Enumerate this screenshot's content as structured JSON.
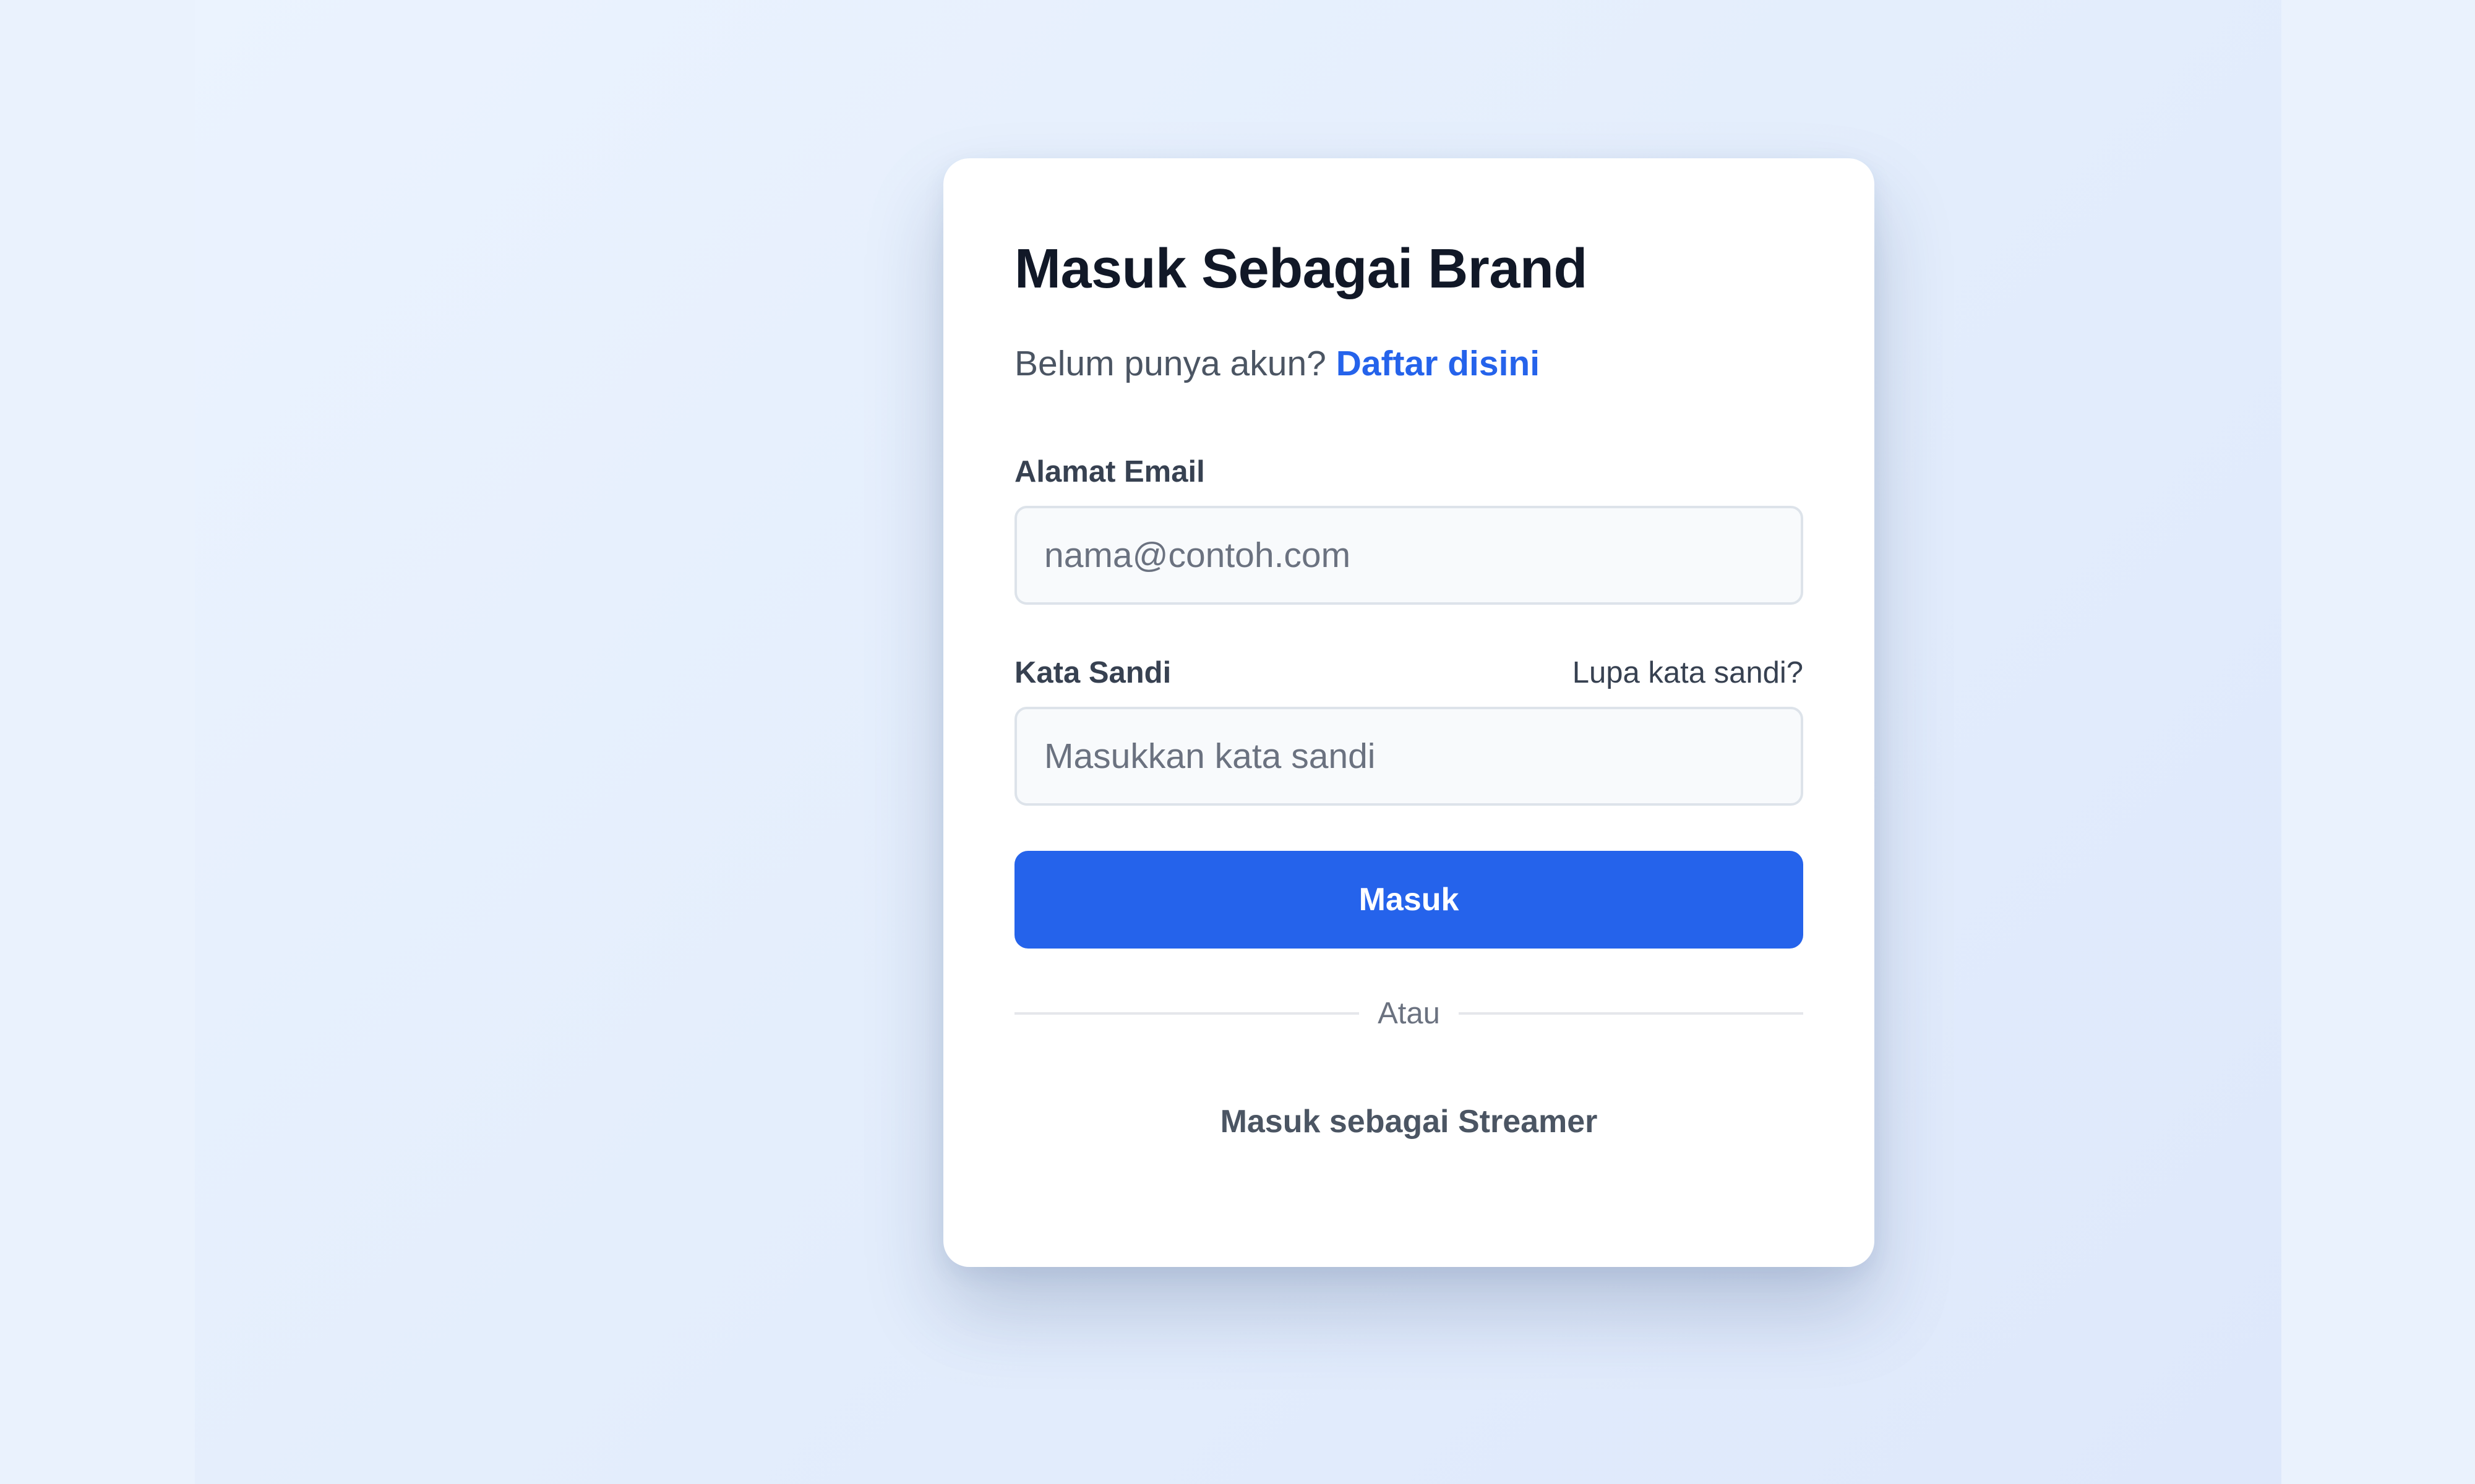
{
  "login": {
    "title": "Masuk Sebagai Brand",
    "subtitle_text": "Belum punya akun?",
    "register_link": "Daftar disini",
    "email_label": "Alamat Email",
    "email_placeholder": "nama@contoh.com",
    "password_label": "Kata Sandi",
    "forgot_link": "Lupa kata sandi?",
    "password_placeholder": "Masukkan kata sandi",
    "submit_label": "Masuk",
    "divider_text": "Atau",
    "alt_login_link": "Masuk sebagai Streamer"
  },
  "colors": {
    "accent": "#2563eb",
    "background": "#e7f0fd",
    "card": "#ffffff",
    "heading": "#111827"
  }
}
